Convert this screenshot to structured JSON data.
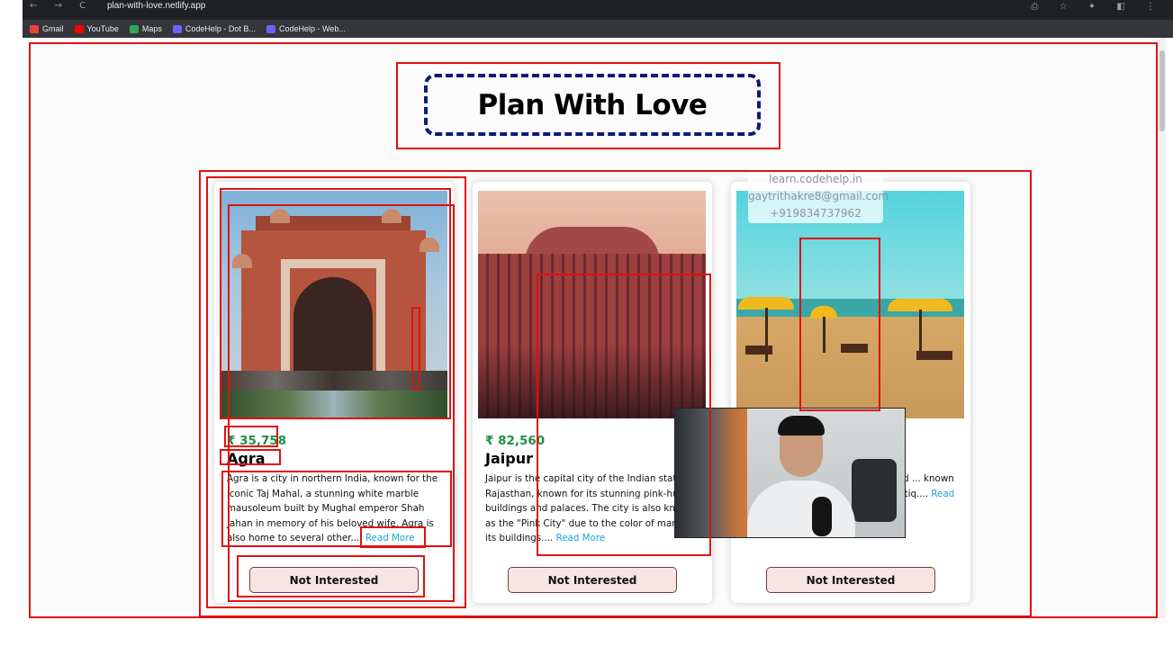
{
  "browser": {
    "url": "plan-with-love.netlify.app",
    "nav_glyphs": "← → C",
    "right_glyphs": "⎙ ☆ ✦ ◧ ⋮",
    "bookmarks": [
      {
        "label": "Gmail",
        "color": "#ea4335"
      },
      {
        "label": "YouTube",
        "color": "#ff0000"
      },
      {
        "label": "Maps",
        "color": "#34a853"
      },
      {
        "label": "CodeHelp - Dot B...",
        "color": "#6c63ff"
      },
      {
        "label": "CodeHelp - Web...",
        "color": "#6c63ff"
      }
    ]
  },
  "page": {
    "title": "Plan With Love",
    "watermark": {
      "site": "learn.codehelp.in",
      "email": "gaytrithakre8@gmail.com",
      "phone": "+919834737962"
    }
  },
  "tours": [
    {
      "price": "₹ 35,758",
      "city": "Agra",
      "description": "Agra is a city in northern India, known for the iconic Taj Mahal, a stunning white marble mausoleum built by Mughal emperor Shah Jahan in memory of his beloved wife. Agra is also home to several other....",
      "read_more": "Read More",
      "button": "Not Interested"
    },
    {
      "price": "₹ 82,560",
      "city": "Jaipur",
      "description": "Jaipur is the capital city of the Indian state of Rajasthan, known for its stunning pink-hued buildings and palaces. The city is also known as the \"Pink City\" due to the color of many of its buildings....",
      "read_more": "Read More",
      "button": "Not Interested"
    },
    {
      "price": "",
      "city": "",
      "description": "... western coast, ... vibrant ... ... ed ... known for its spicy seafood dishes and antiq....",
      "read_more": "Read More",
      "button": "Not Interested"
    }
  ],
  "colors": {
    "price": "#1d8f44",
    "read_more": "#1aa3d6",
    "button_bg": "#f7e4e4",
    "title_border": "#0b1a7a",
    "debug_outline": "#e01010"
  }
}
